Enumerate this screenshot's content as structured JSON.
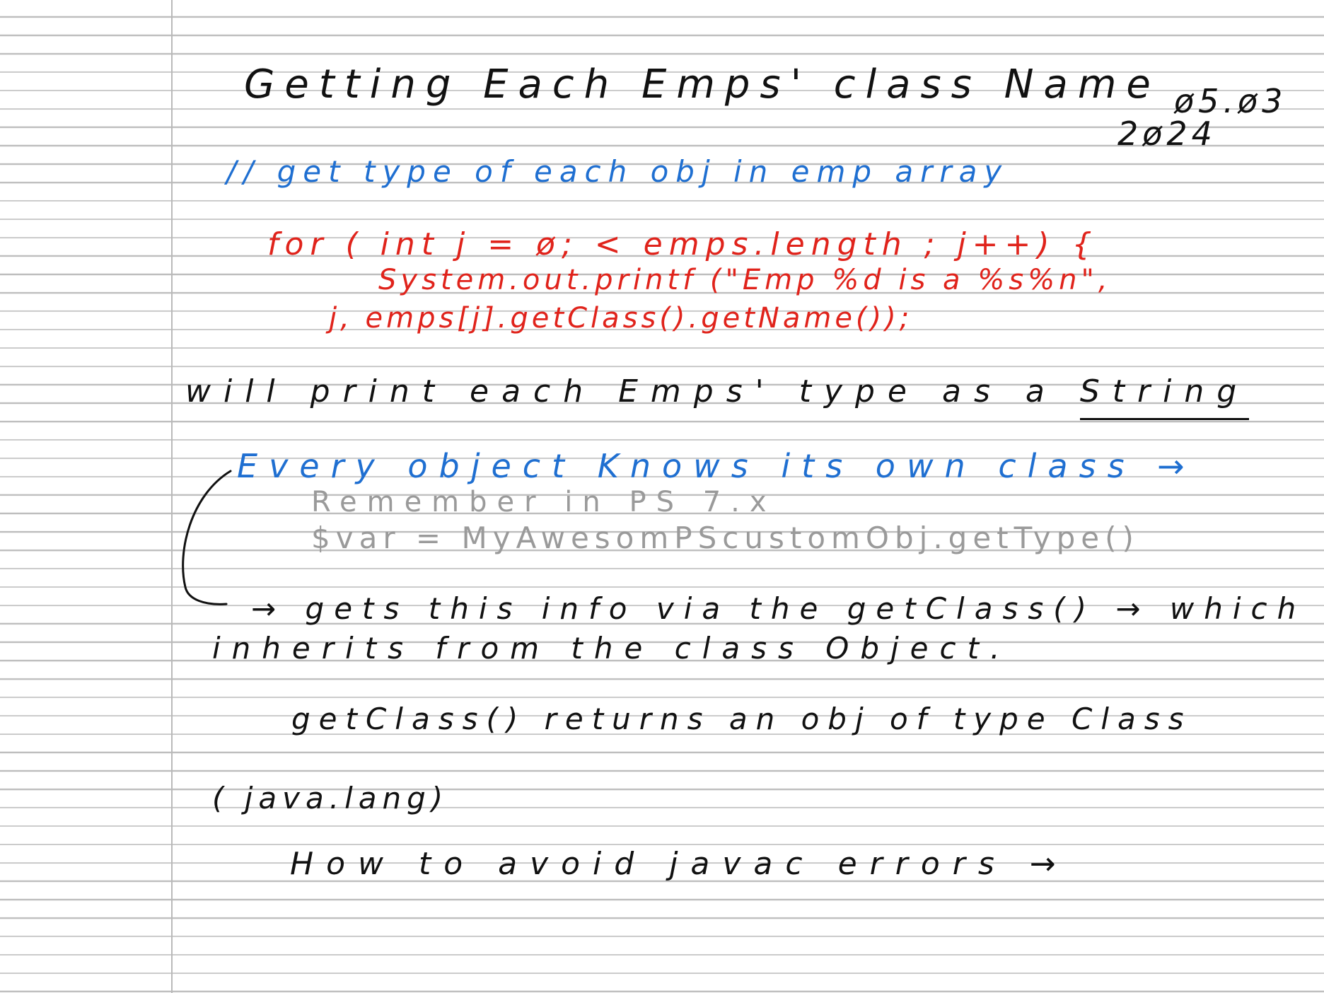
{
  "note": {
    "title": "Getting Each Emps' class Name",
    "date_line1": "ø5.ø3",
    "date_line2": "2ø24",
    "comment": "// get type of each obj in emp array",
    "code": {
      "line1": "for ( int j = ø; < emps.length ; j++) {",
      "line2": "System.out.printf (\"Emp %d is a %s%n\",",
      "line3": "j, emps[j].getClass().getName());"
    },
    "will_print_prefix": "will print each Emps' type as a",
    "will_print_underlined": "String",
    "every_object": "Every object Knows its own class →",
    "remember": "Remember in PS 7.x",
    "powershell_example": "$var = MyAwesomPScustomObj.getType()",
    "gets_info": "→ gets this info via the getClass() → which",
    "inherits": "inherits from the class Object.",
    "getclass_returns": "getClass() returns an obj of type Class",
    "java_lang": "( java.lang)",
    "avoid_errors": "How to avoid javac errors →"
  },
  "colors": {
    "ink_black": "#111111",
    "ink_blue": "#1f6fd1",
    "ink_red": "#e0231b",
    "ink_gray": "#9a9a9a",
    "rule_line": "#bdbdbd"
  }
}
